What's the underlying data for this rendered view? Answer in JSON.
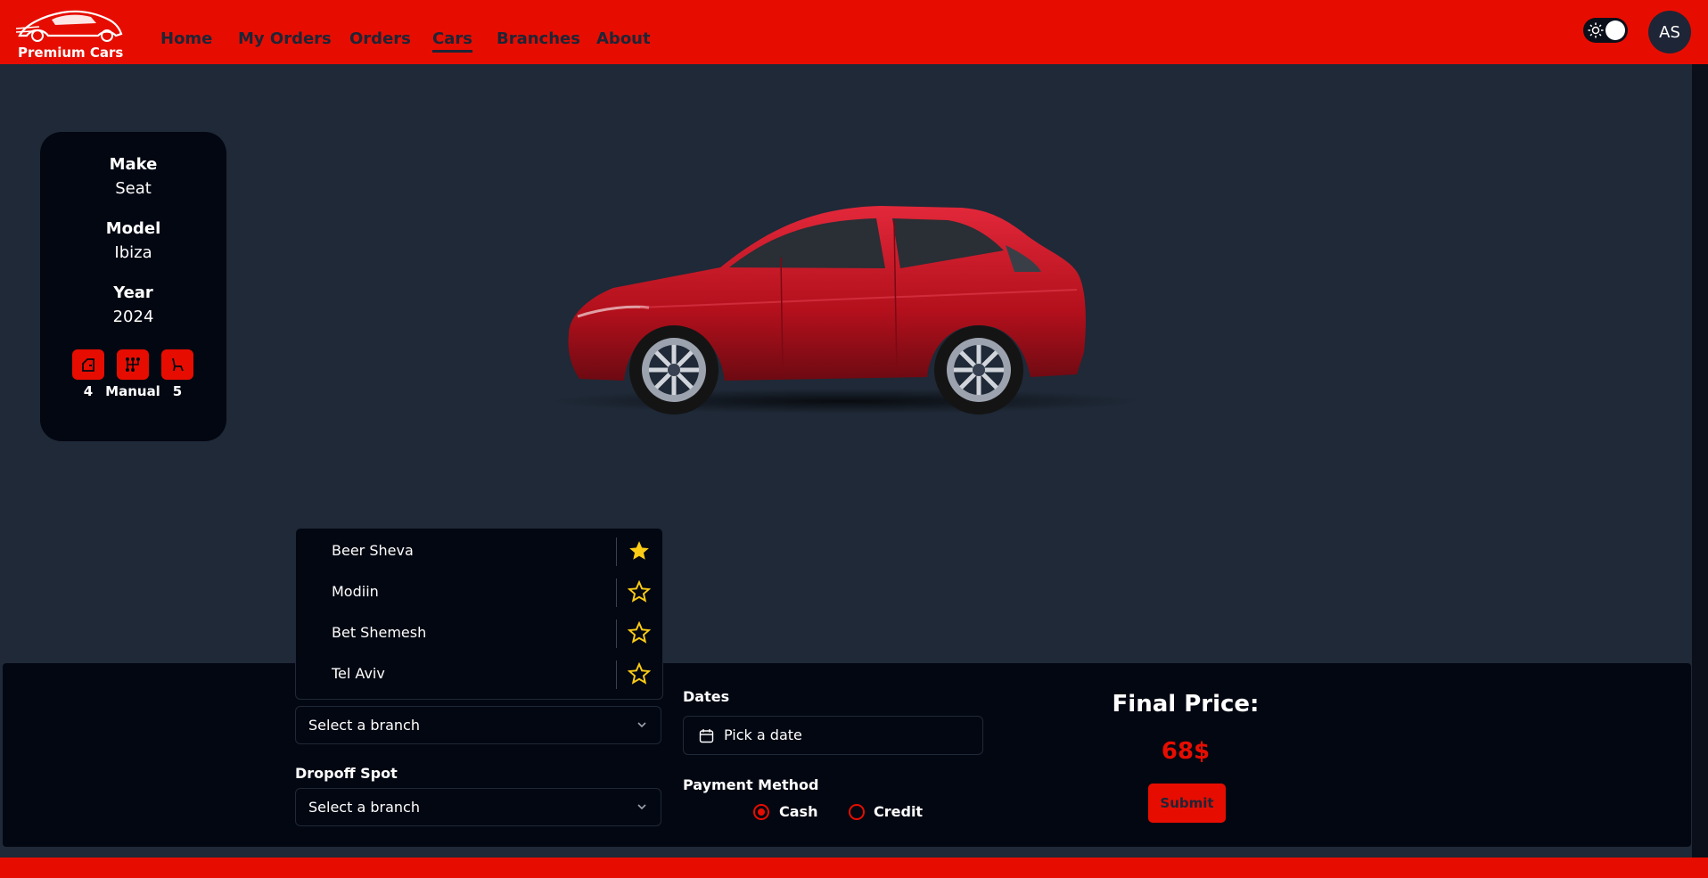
{
  "app": {
    "brand": "Premium Cars",
    "nav": [
      "Home",
      "My Orders",
      "Orders",
      "Cars",
      "Branches",
      "About"
    ],
    "active_nav": "Cars",
    "user_initials": "AS"
  },
  "car": {
    "make_label": "Make",
    "make": "Seat",
    "model_label": "Model",
    "model": "Ibiza",
    "year_label": "Year",
    "year": "2024",
    "features": [
      {
        "icon": "car-door-icon",
        "value": "4"
      },
      {
        "icon": "gearbox-icon",
        "value": "Manual"
      },
      {
        "icon": "car-seat-icon",
        "value": "5"
      }
    ],
    "color": "#c8141f"
  },
  "booking": {
    "pickup_placeholder": "Select a branch",
    "dropoff_label": "Dropoff Spot",
    "dropoff_placeholder": "Select a branch",
    "dates_label": "Dates",
    "date_placeholder": "Pick a date",
    "payment_label": "Payment Method",
    "payment_options": [
      "Cash",
      "Credit"
    ],
    "payment_selected": "Cash",
    "final_price_label": "Final Price:",
    "final_price": "68$",
    "submit_label": "Submit"
  },
  "branches_dropdown": [
    {
      "name": "Beer Sheva",
      "favorite": true
    },
    {
      "name": "Modiin",
      "favorite": false
    },
    {
      "name": "Bet Shemesh",
      "favorite": false
    },
    {
      "name": "Tel Aviv",
      "favorite": false
    }
  ],
  "colors": {
    "accent": "#e60d00",
    "background": "#1f2937",
    "card": "#030712",
    "star": "#facc15"
  }
}
